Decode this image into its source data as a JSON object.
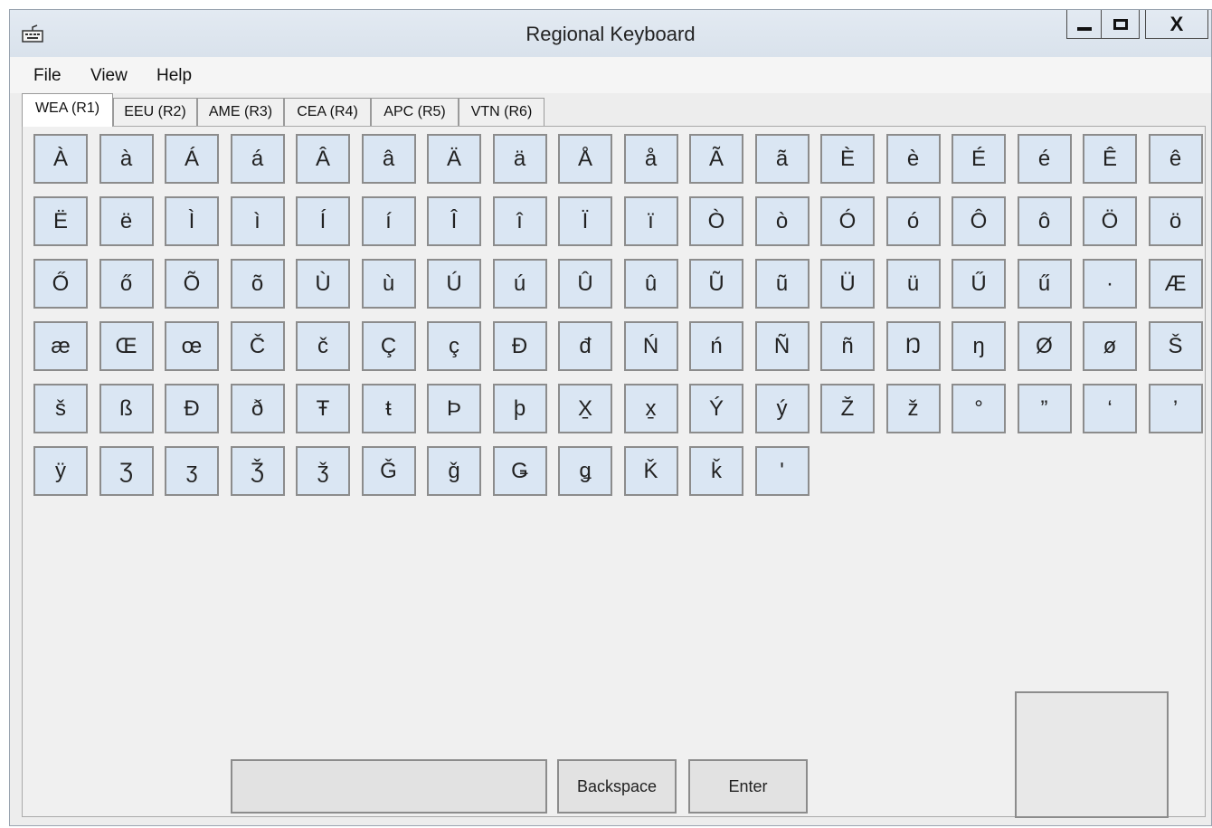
{
  "window": {
    "title": "Regional Keyboard",
    "icon": "keyboard-icon",
    "controls": {
      "minimize": "minimize-icon",
      "maximize": "maximize-icon",
      "close": "X"
    }
  },
  "menu": [
    "File",
    "View",
    "Help"
  ],
  "tabs": [
    "WEA (R1)",
    "EEU (R2)",
    "AME (R3)",
    "CEA (R4)",
    "APC (R5)",
    "VTN (R6)"
  ],
  "active_tab": "WEA (R1)",
  "keys": [
    [
      "À",
      "à",
      "Á",
      "á",
      "Â",
      "â",
      "Ä",
      "ä",
      "Å",
      "å",
      "Ã",
      "ã",
      "È",
      "è",
      "É",
      "é",
      "Ê",
      "ê"
    ],
    [
      "Ë",
      "ë",
      "Ì",
      "ì",
      "Í",
      "í",
      "Î",
      "î",
      "Ï",
      "ï",
      "Ò",
      "ò",
      "Ó",
      "ó",
      "Ô",
      "ô",
      "Ö",
      "ö"
    ],
    [
      "Ő",
      "ő",
      "Õ",
      "õ",
      "Ù",
      "ù",
      "Ú",
      "ú",
      "Û",
      "û",
      "Ũ",
      "ũ",
      "Ü",
      "ü",
      "Ű",
      "ű",
      "·",
      "Æ"
    ],
    [
      "æ",
      "Œ",
      "œ",
      "Č",
      "č",
      "Ç",
      "ç",
      "Đ",
      "đ",
      "Ń",
      "ń",
      "Ñ",
      "ñ",
      "Ŋ",
      "ŋ",
      "Ø",
      "ø",
      "Š"
    ],
    [
      "š",
      "ß",
      "Ð",
      "ð",
      "Ŧ",
      "ŧ",
      "Þ",
      "þ",
      "X̱",
      "x̱",
      "Ý",
      "ý",
      "Ž",
      "ž",
      "°",
      "”",
      "‘",
      "’"
    ],
    [
      "ÿ",
      "Ʒ",
      "ʒ",
      "Ǯ",
      "ǯ",
      "Ǧ",
      "ǧ",
      "Ǥ",
      "ǥ",
      "Ǩ",
      "ǩ",
      "ʹ"
    ]
  ],
  "input": {
    "value": ""
  },
  "buttons": {
    "backspace": "Backspace",
    "enter": "Enter"
  },
  "colors": {
    "key_fill": "#dae6f3",
    "window_bg": "#ededed",
    "titlebar": "#dfe7ef"
  }
}
